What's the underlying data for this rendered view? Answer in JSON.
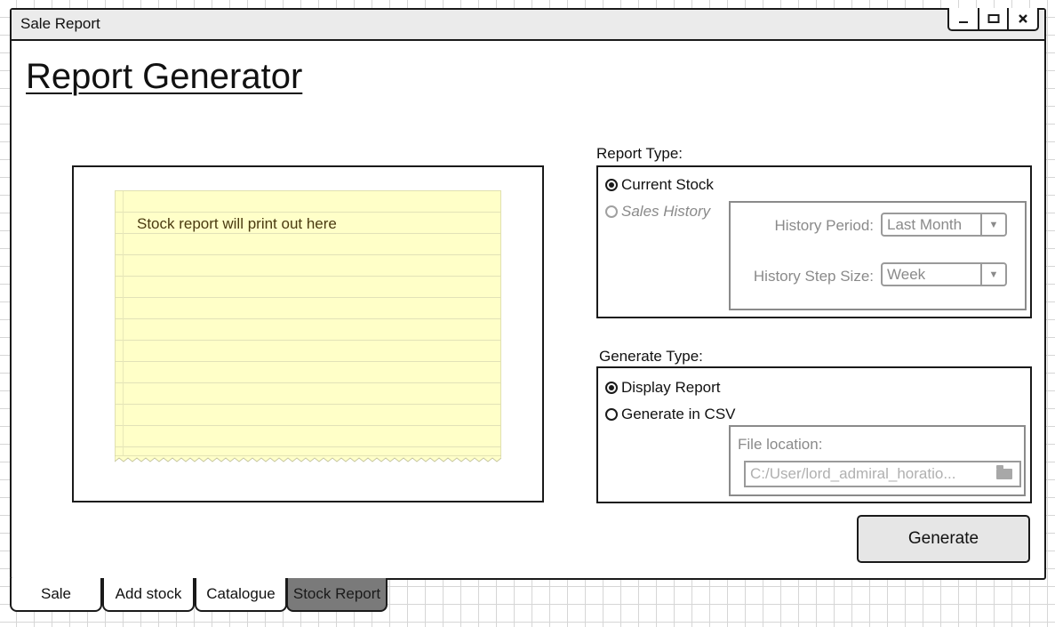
{
  "window": {
    "title": "Sale Report",
    "controls": [
      "minimize-icon",
      "maximize-icon",
      "close-icon"
    ]
  },
  "page": {
    "title": "Report Generator"
  },
  "preview": {
    "text": "Stock report will print out here"
  },
  "report_type": {
    "label": "Report Type:",
    "options": [
      {
        "label": "Current Stock",
        "selected": true,
        "enabled": true
      },
      {
        "label": "Sales History",
        "selected": false,
        "enabled": false
      }
    ],
    "history_period": {
      "label": "History Period:",
      "value": "Last Month"
    },
    "history_step": {
      "label": "History Step Size:",
      "value": "Week"
    }
  },
  "generate_type": {
    "label": "Generate Type:",
    "options": [
      {
        "label": "Display Report",
        "selected": true
      },
      {
        "label": "Generate in CSV",
        "selected": false
      }
    ],
    "file_location": {
      "label": "File location:",
      "value": "C:/User/lord_admiral_horatio..."
    }
  },
  "generate_button": {
    "label": "Generate"
  },
  "tabs": [
    {
      "label": "Sale",
      "active": false
    },
    {
      "label": "Add stock",
      "active": false
    },
    {
      "label": "Catalogue",
      "active": false
    },
    {
      "label": "Stock Report",
      "active": true
    }
  ]
}
